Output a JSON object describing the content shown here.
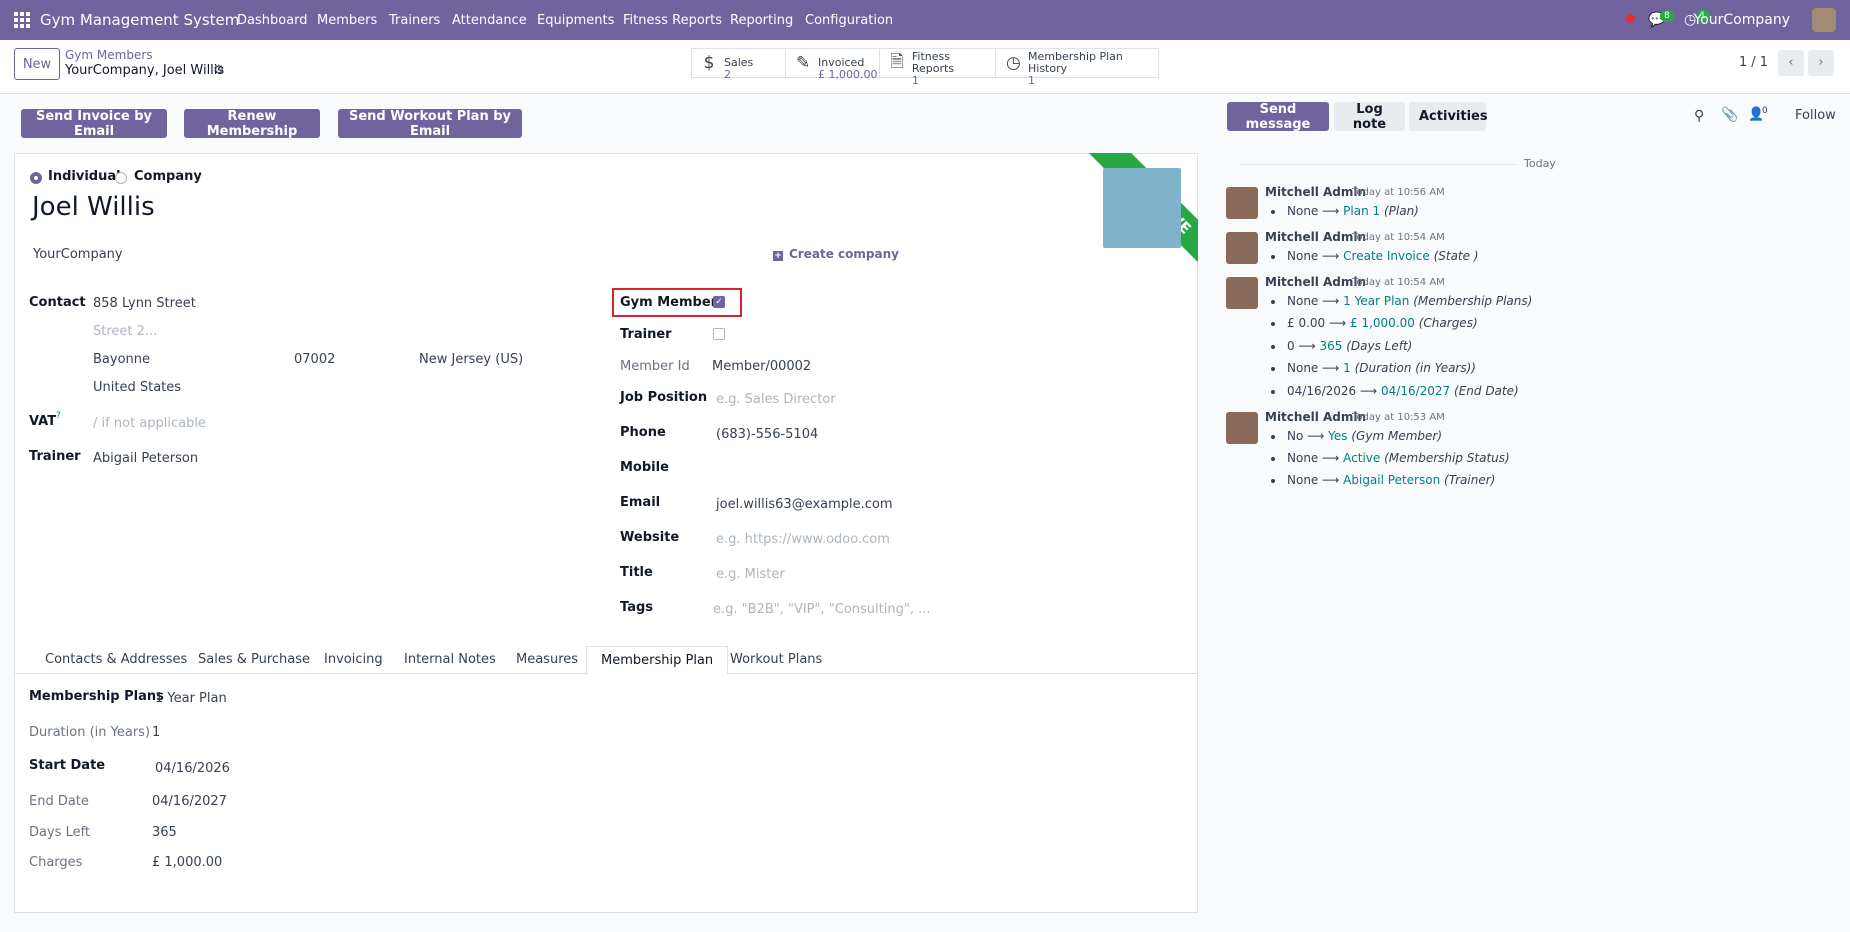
{
  "topbar": {
    "brand": "Gym Management System",
    "menu": [
      "Dashboard",
      "Members",
      "Trainers",
      "Attendance",
      "Equipments",
      "Fitness Reports",
      "Reporting",
      "Configuration"
    ],
    "messages_count": "8",
    "activities_count": "1",
    "company": "YourCompany"
  },
  "control_panel": {
    "new_label": "New",
    "breadcrumb_parent": "Gym Members",
    "breadcrumb_title": "YourCompany, Joel Willis",
    "pager": "1 / 1",
    "smart_buttons": [
      {
        "label": "Sales",
        "value": "2",
        "icon": "dollar-icon"
      },
      {
        "label": "Invoiced",
        "value": "£ 1,000.00",
        "icon": "edit-icon"
      },
      {
        "label": "Fitness Reports",
        "value": "1",
        "icon": "file-icon"
      },
      {
        "label": "Membership Plan History",
        "value": "1",
        "icon": "clock-icon"
      }
    ]
  },
  "actions": [
    "Send Invoice by Email",
    "Renew Membership",
    "Send Workout Plan by Email"
  ],
  "form": {
    "type_individual": "Individual",
    "type_company": "Company",
    "name": "Joel Willis",
    "parent_company": "YourCompany",
    "create_company": "Create company",
    "ribbon": "ACTIVE",
    "contact_label": "Contact",
    "street": "858 Lynn Street",
    "street2_placeholder": "Street 2...",
    "city": "Bayonne",
    "zip": "07002",
    "state": "New Jersey (US)",
    "country": "United States",
    "vat_label": "VAT",
    "vat_help": "?",
    "vat_placeholder": "/ if not applicable",
    "trainer_label": "Trainer",
    "trainer_value": "Abigail Peterson",
    "gym_member_label": "Gym Member",
    "trainer_check_label": "Trainer",
    "member_id_label": "Member Id",
    "member_id_value": "Member/00002",
    "job_position_label": "Job Position",
    "job_position_placeholder": "e.g. Sales Director",
    "phone_label": "Phone",
    "phone_value": "(683)-556-5104",
    "mobile_label": "Mobile",
    "email_label": "Email",
    "email_value": "joel.willis63@example.com",
    "website_label": "Website",
    "website_placeholder": "e.g. https://www.odoo.com",
    "title_label": "Title",
    "title_placeholder": "e.g. Mister",
    "tags_label": "Tags",
    "tags_placeholder": "e.g. \"B2B\", \"VIP\", \"Consulting\", ..."
  },
  "tabs": [
    "Contacts & Addresses",
    "Sales & Purchase",
    "Invoicing",
    "Internal Notes",
    "Measures",
    "Membership Plan",
    "Workout Plans"
  ],
  "membership": {
    "plans_label": "Membership Plans",
    "plans_value": "1 Year Plan",
    "duration_label": "Duration (in Years)",
    "duration_value": "1",
    "start_label": "Start Date",
    "start_value": "04/16/2026",
    "end_label": "End Date",
    "end_value": "04/16/2027",
    "days_label": "Days Left",
    "days_value": "365",
    "charges_label": "Charges",
    "charges_value": "£ 1,000.00"
  },
  "chatter": {
    "send_message": "Send message",
    "log_note": "Log note",
    "activities": "Activities",
    "followers_count": "0",
    "follow": "Follow",
    "day": "Today",
    "entries": [
      {
        "author": "Mitchell Admin",
        "time": "Today at 10:56 AM",
        "changes": [
          {
            "old": "None",
            "new": "Plan 1",
            "field": "(Plan)"
          }
        ]
      },
      {
        "author": "Mitchell Admin",
        "time": "Today at 10:54 AM",
        "changes": [
          {
            "old": "None",
            "new": "Create Invoice",
            "field": "(State )"
          }
        ]
      },
      {
        "author": "Mitchell Admin",
        "time": "Today at 10:54 AM",
        "changes": [
          {
            "old": "None",
            "new": "1 Year Plan",
            "field": "(Membership Plans)"
          },
          {
            "old": "£ 0.00",
            "new": "£ 1,000.00",
            "field": "(Charges)"
          },
          {
            "old": "0",
            "new": "365",
            "field": "(Days Left)"
          },
          {
            "old": "None",
            "new": "1",
            "field": "(Duration (in Years))"
          },
          {
            "old": "04/16/2026",
            "new": "04/16/2027",
            "field": "(End Date)"
          }
        ]
      },
      {
        "author": "Mitchell Admin",
        "time": "Today at 10:53 AM",
        "changes": [
          {
            "old": "No",
            "new": "Yes",
            "field": "(Gym Member)"
          },
          {
            "old": "None",
            "new": "Active",
            "field": "(Membership Status)"
          },
          {
            "old": "None",
            "new": "Abigail Peterson",
            "field": "(Trainer)"
          }
        ]
      }
    ]
  }
}
